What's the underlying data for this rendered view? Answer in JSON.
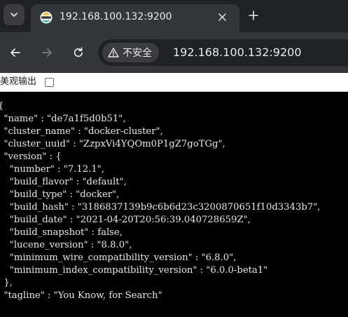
{
  "tab": {
    "title": "192.168.100.132:9200",
    "favicon": "elastic-logo-icon",
    "close_icon": "close-icon"
  },
  "tabstrip": {
    "tab_search_icon": "chevron-down-icon",
    "new_tab_icon": "plus-icon"
  },
  "toolbar": {
    "back_icon": "arrow-left-icon",
    "forward_icon": "arrow-right-icon",
    "reload_icon": "reload-icon",
    "security_icon": "warning-triangle-icon",
    "security_label": "不安全",
    "url": "192.168.100.132:9200"
  },
  "extension": {
    "pretty_print_label": "美观输出",
    "pretty_print_checked": false
  },
  "response": {
    "lines": [
      "{",
      "  \"name\" : \"de7a1f5d0b51\",",
      "  \"cluster_name\" : \"docker-cluster\",",
      "  \"cluster_uuid\" : \"ZzpxVi4YQOm0P1gZ7goTGg\",",
      "  \"version\" : {",
      "    \"number\" : \"7.12.1\",",
      "    \"build_flavor\" : \"default\",",
      "    \"build_type\" : \"docker\",",
      "    \"build_hash\" : \"3186837139b9c6b6d23c3200870651f10d3343b7\",",
      "    \"build_date\" : \"2021-04-20T20:56:39.040728659Z\",",
      "    \"build_snapshot\" : false,",
      "    \"lucene_version\" : \"8.8.0\",",
      "    \"minimum_wire_compatibility_version\" : \"6.8.0\",",
      "    \"minimum_index_compatibility_version\" : \"6.0.0-beta1\"",
      "  },",
      "  \"tagline\" : \"You Know, for Search\""
    ]
  },
  "colors": {
    "tabstrip_bg": "#202124",
    "toolbar_bg": "#35363a",
    "omnibox_bg": "#202124",
    "content_bg": "#000000",
    "text": "#e8e8e8"
  }
}
